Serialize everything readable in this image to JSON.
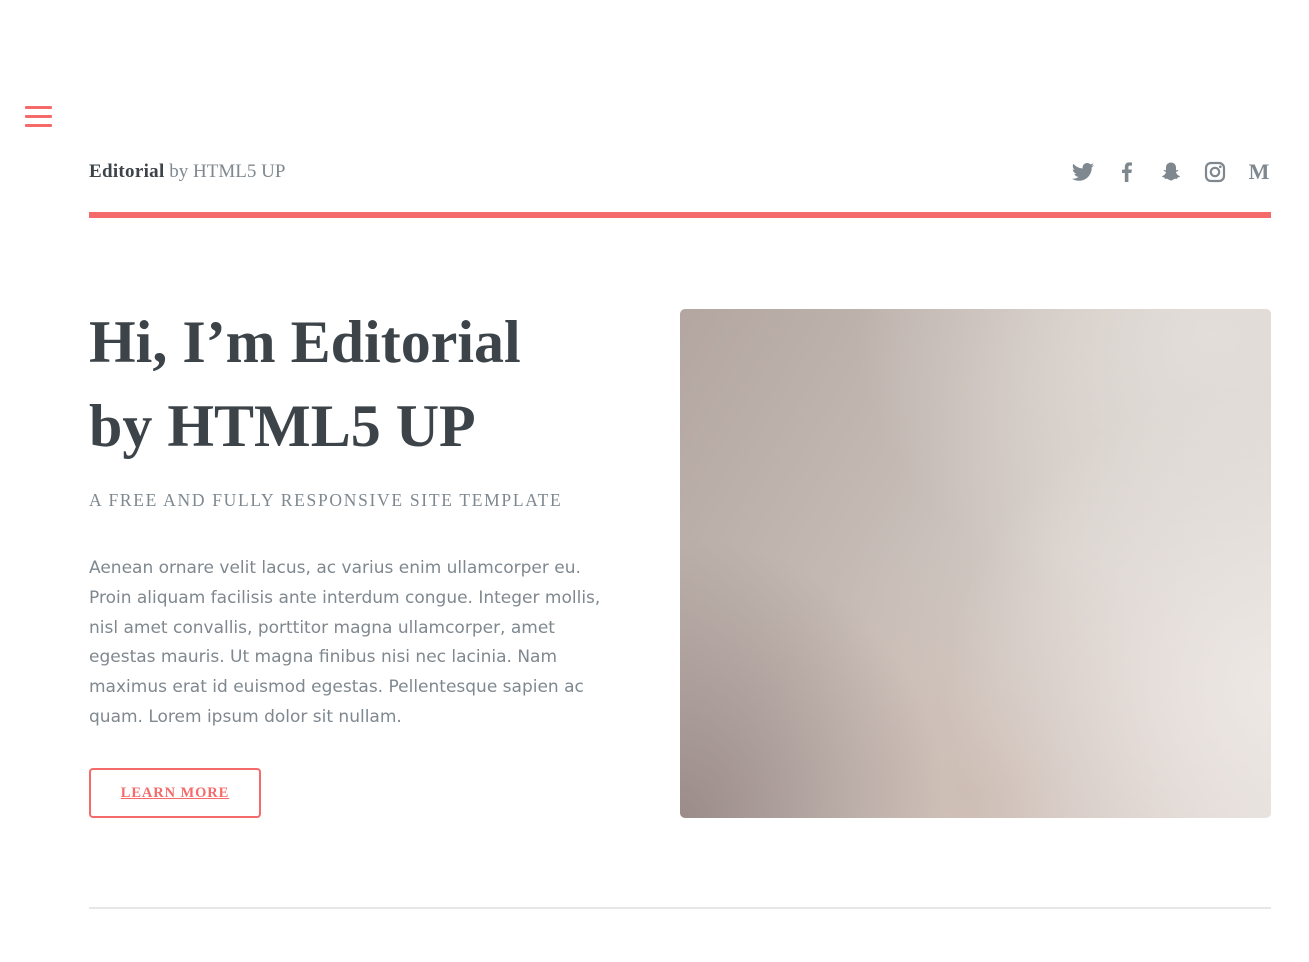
{
  "colors": {
    "accent": "#f56a6a",
    "heading": "#3d4449",
    "text": "#7f888f",
    "rule": "#e4e6e8"
  },
  "menu": {
    "icon": "hamburger-menu-icon"
  },
  "header": {
    "logo_strong": "Editorial",
    "logo_rest": " by HTML5 UP",
    "icons": [
      "twitter-icon",
      "facebook-icon",
      "snapchat-icon",
      "instagram-icon",
      "medium-icon"
    ],
    "medium_glyph": "M"
  },
  "banner": {
    "title_line1": "Hi, I’m Editorial",
    "title_line2": "by HTML5 UP",
    "subtitle": "A FREE AND FULLY RESPONSIVE SITE TEMPLATE",
    "body": "Aenean ornare velit lacus, ac varius enim ullamcorper eu. Proin aliquam facilisis ante interdum congue. Integer mollis, nisl amet convallis, porttitor magna ullamcorper, amet egestas mauris. Ut magna finibus nisi nec lacinia. Nam maximus erat id euismod egestas. Pellentesque sapien ac quam. Lorem ipsum dolor sit nullam.",
    "button_label": "LEARN MORE"
  }
}
